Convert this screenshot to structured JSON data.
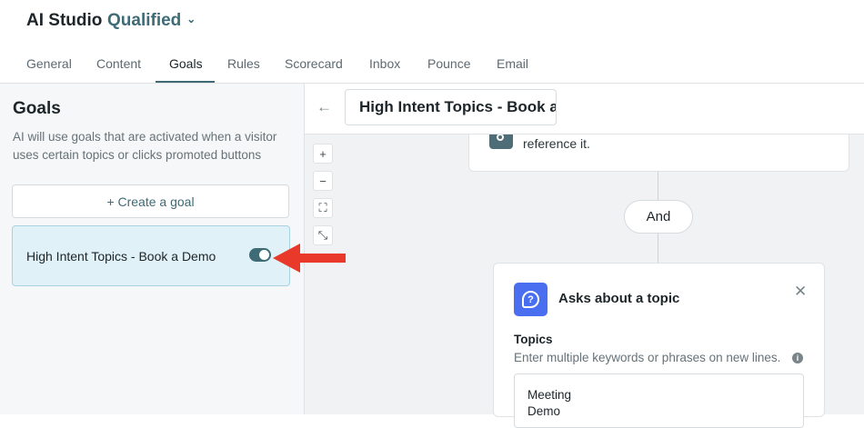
{
  "header": {
    "app_title": "AI Studio",
    "org_name": "Qualified"
  },
  "tabs": [
    "General",
    "Content",
    "Goals",
    "Rules",
    "Scorecard",
    "Inbox",
    "Pounce",
    "Email"
  ],
  "active_tab": "Goals",
  "left_panel": {
    "title": "Goals",
    "description": "AI will use goals that are activated when a visitor uses certain topics or clicks promoted buttons",
    "create_label": "+ Create a goal",
    "goal": {
      "label": "High Intent Topics - Book a Demo",
      "enabled": true
    }
  },
  "editor": {
    "goal_name": "High Intent Topics - Book a Demo",
    "zoom_controls": [
      "+",
      "−",
      "⛶",
      "⤡"
    ],
    "previous_card_text": "reference it.",
    "and_label": "And",
    "topic_card": {
      "title": "Asks about a topic",
      "topics_label": "Topics",
      "topics_help": "Enter multiple keywords or phrases on new lines.",
      "topics_value": "Meeting\nDemo"
    }
  },
  "colors": {
    "accent": "#3e6b76",
    "goal_highlight": "#e0f2f7",
    "topic_icon": "#4a6ef0",
    "annotation_arrow": "#e8392a"
  }
}
